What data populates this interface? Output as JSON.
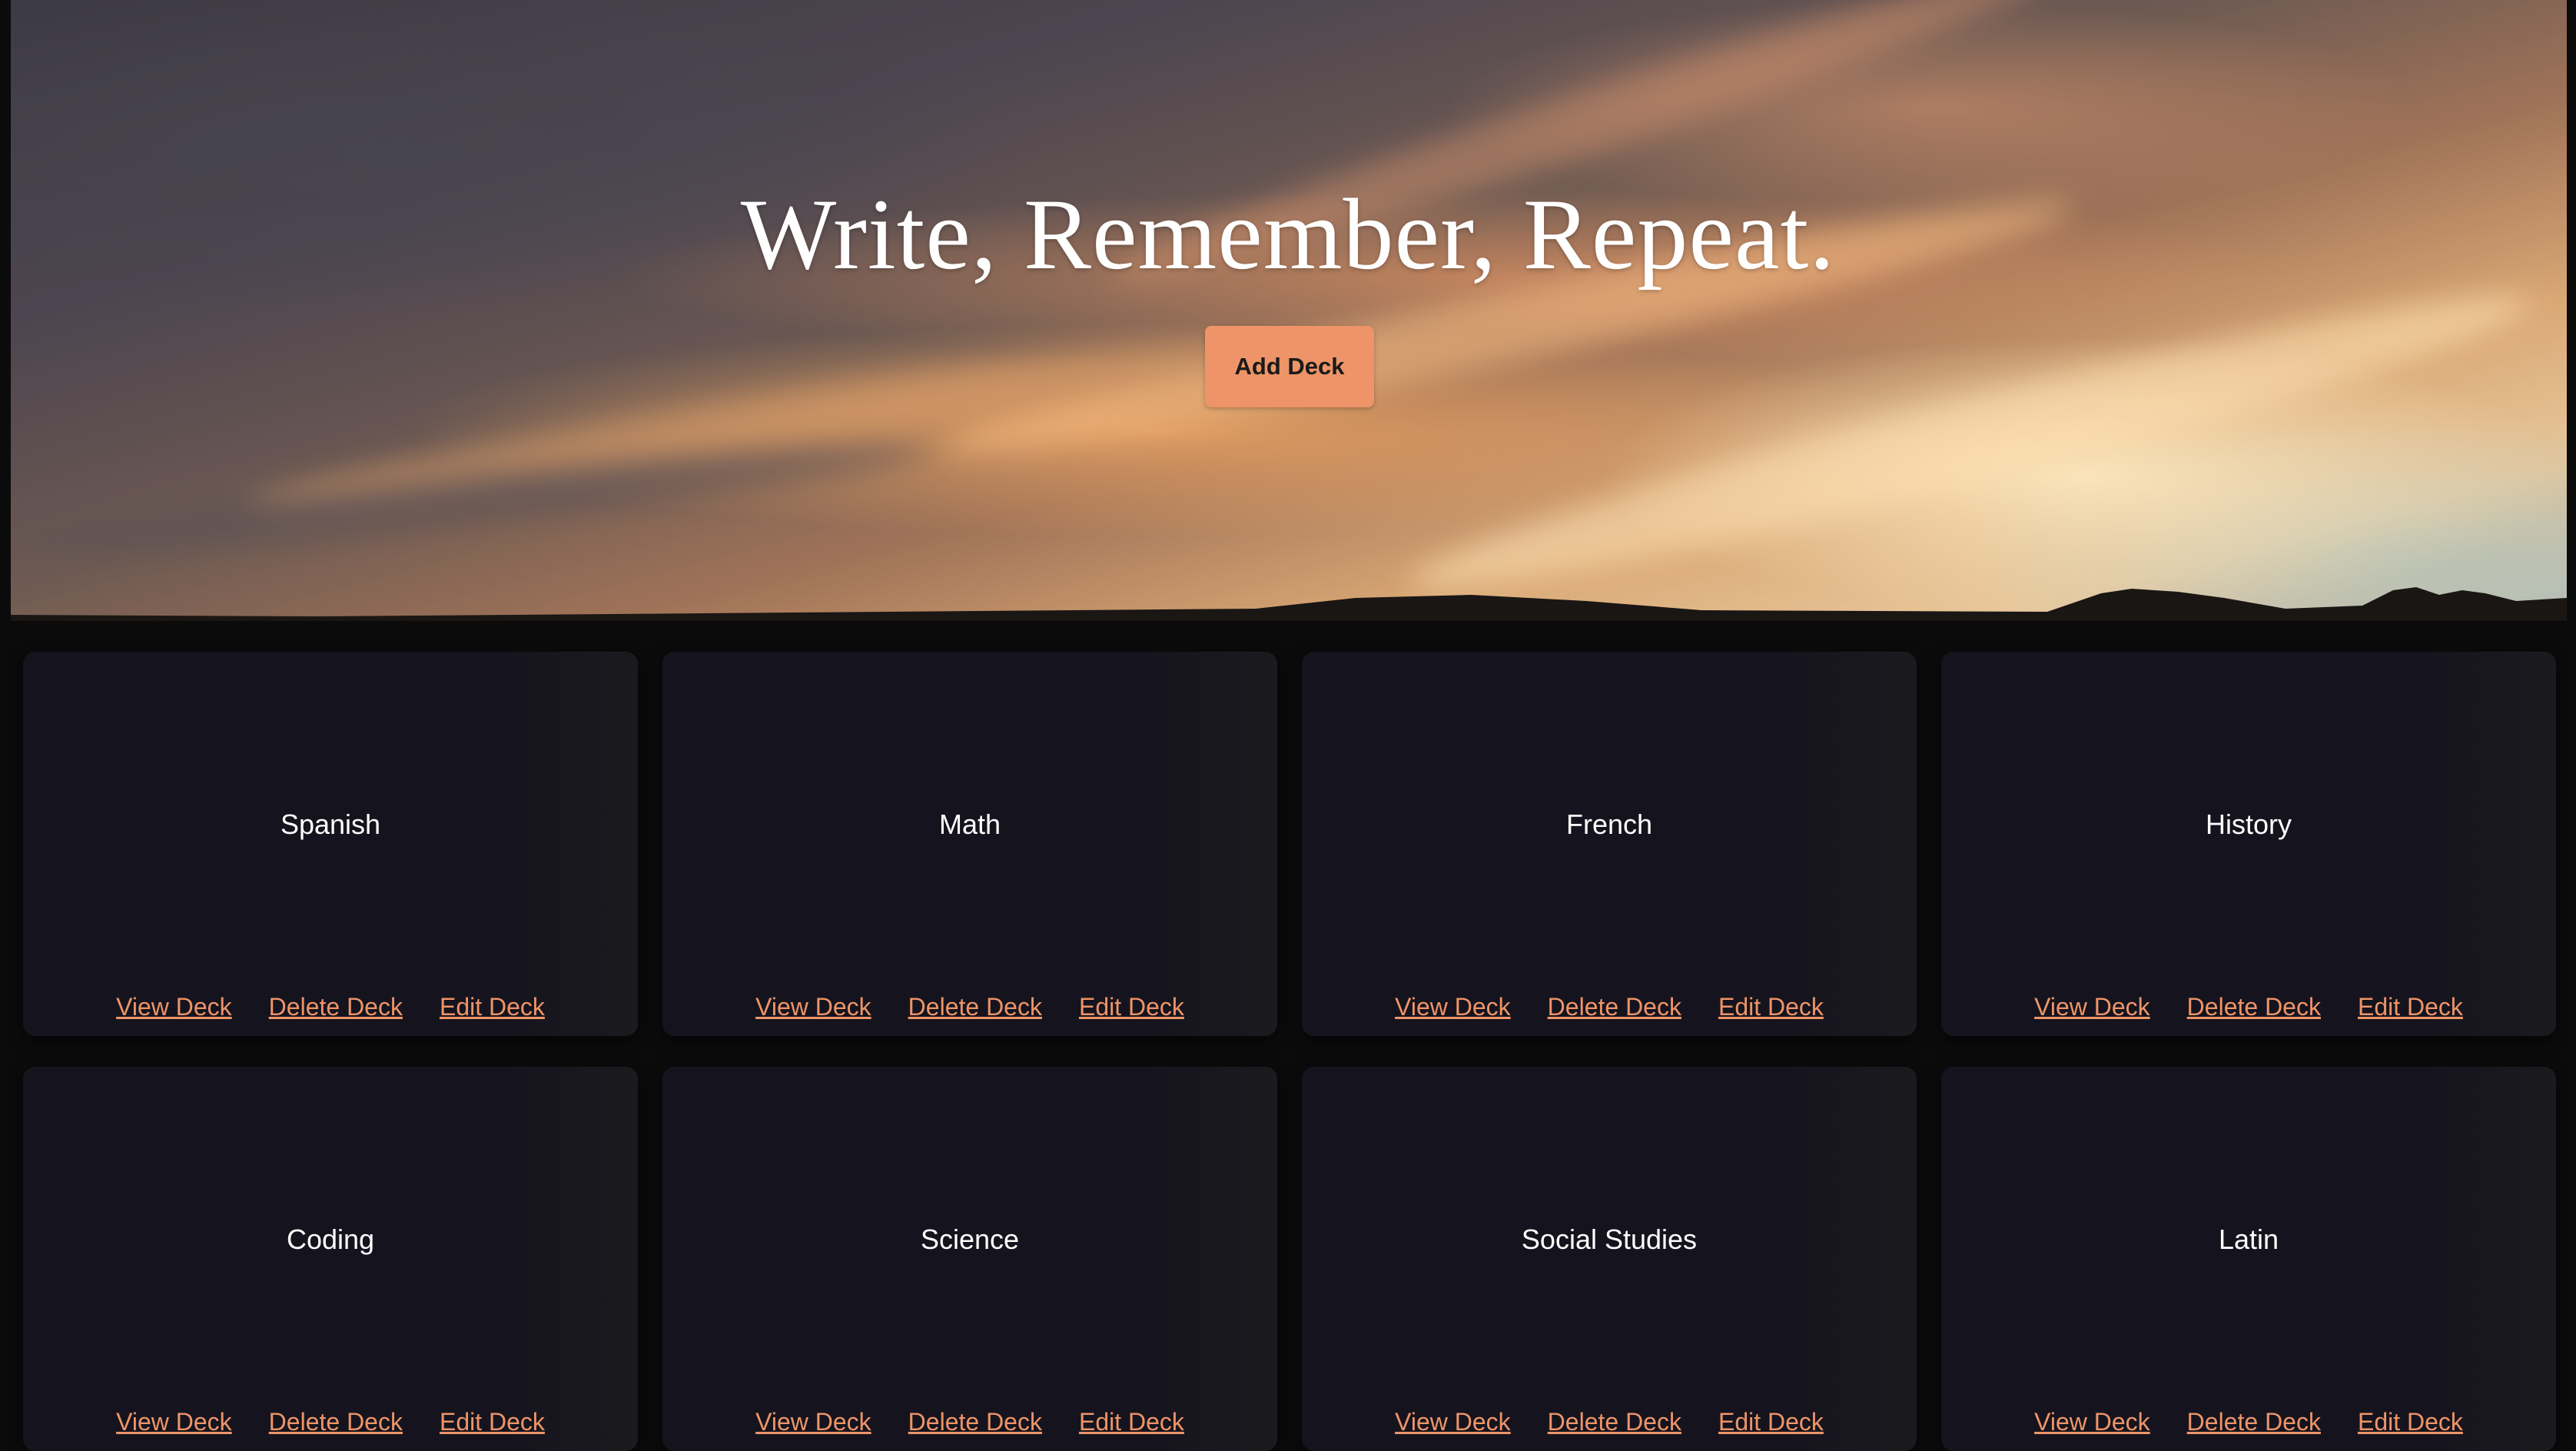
{
  "hero": {
    "title": "Write, Remember, Repeat.",
    "add_button_label": "Add Deck"
  },
  "colors": {
    "accent": "#ee9468",
    "card_bg": "#15141e",
    "page_bg": "#0c0b0c"
  },
  "decks": [
    {
      "name": "Spanish",
      "view_label": "View Deck",
      "delete_label": "Delete Deck",
      "edit_label": "Edit Deck"
    },
    {
      "name": "Math",
      "view_label": "View Deck",
      "delete_label": "Delete Deck",
      "edit_label": "Edit Deck"
    },
    {
      "name": "French",
      "view_label": "View Deck",
      "delete_label": "Delete Deck",
      "edit_label": "Edit Deck"
    },
    {
      "name": "History",
      "view_label": "View Deck",
      "delete_label": "Delete Deck",
      "edit_label": "Edit Deck"
    },
    {
      "name": "Coding",
      "view_label": "View Deck",
      "delete_label": "Delete Deck",
      "edit_label": "Edit Deck"
    },
    {
      "name": "Science",
      "view_label": "View Deck",
      "delete_label": "Delete Deck",
      "edit_label": "Edit Deck"
    },
    {
      "name": "Social Studies",
      "view_label": "View Deck",
      "delete_label": "Delete Deck",
      "edit_label": "Edit Deck"
    },
    {
      "name": "Latin",
      "view_label": "View Deck",
      "delete_label": "Delete Deck",
      "edit_label": "Edit Deck"
    }
  ]
}
